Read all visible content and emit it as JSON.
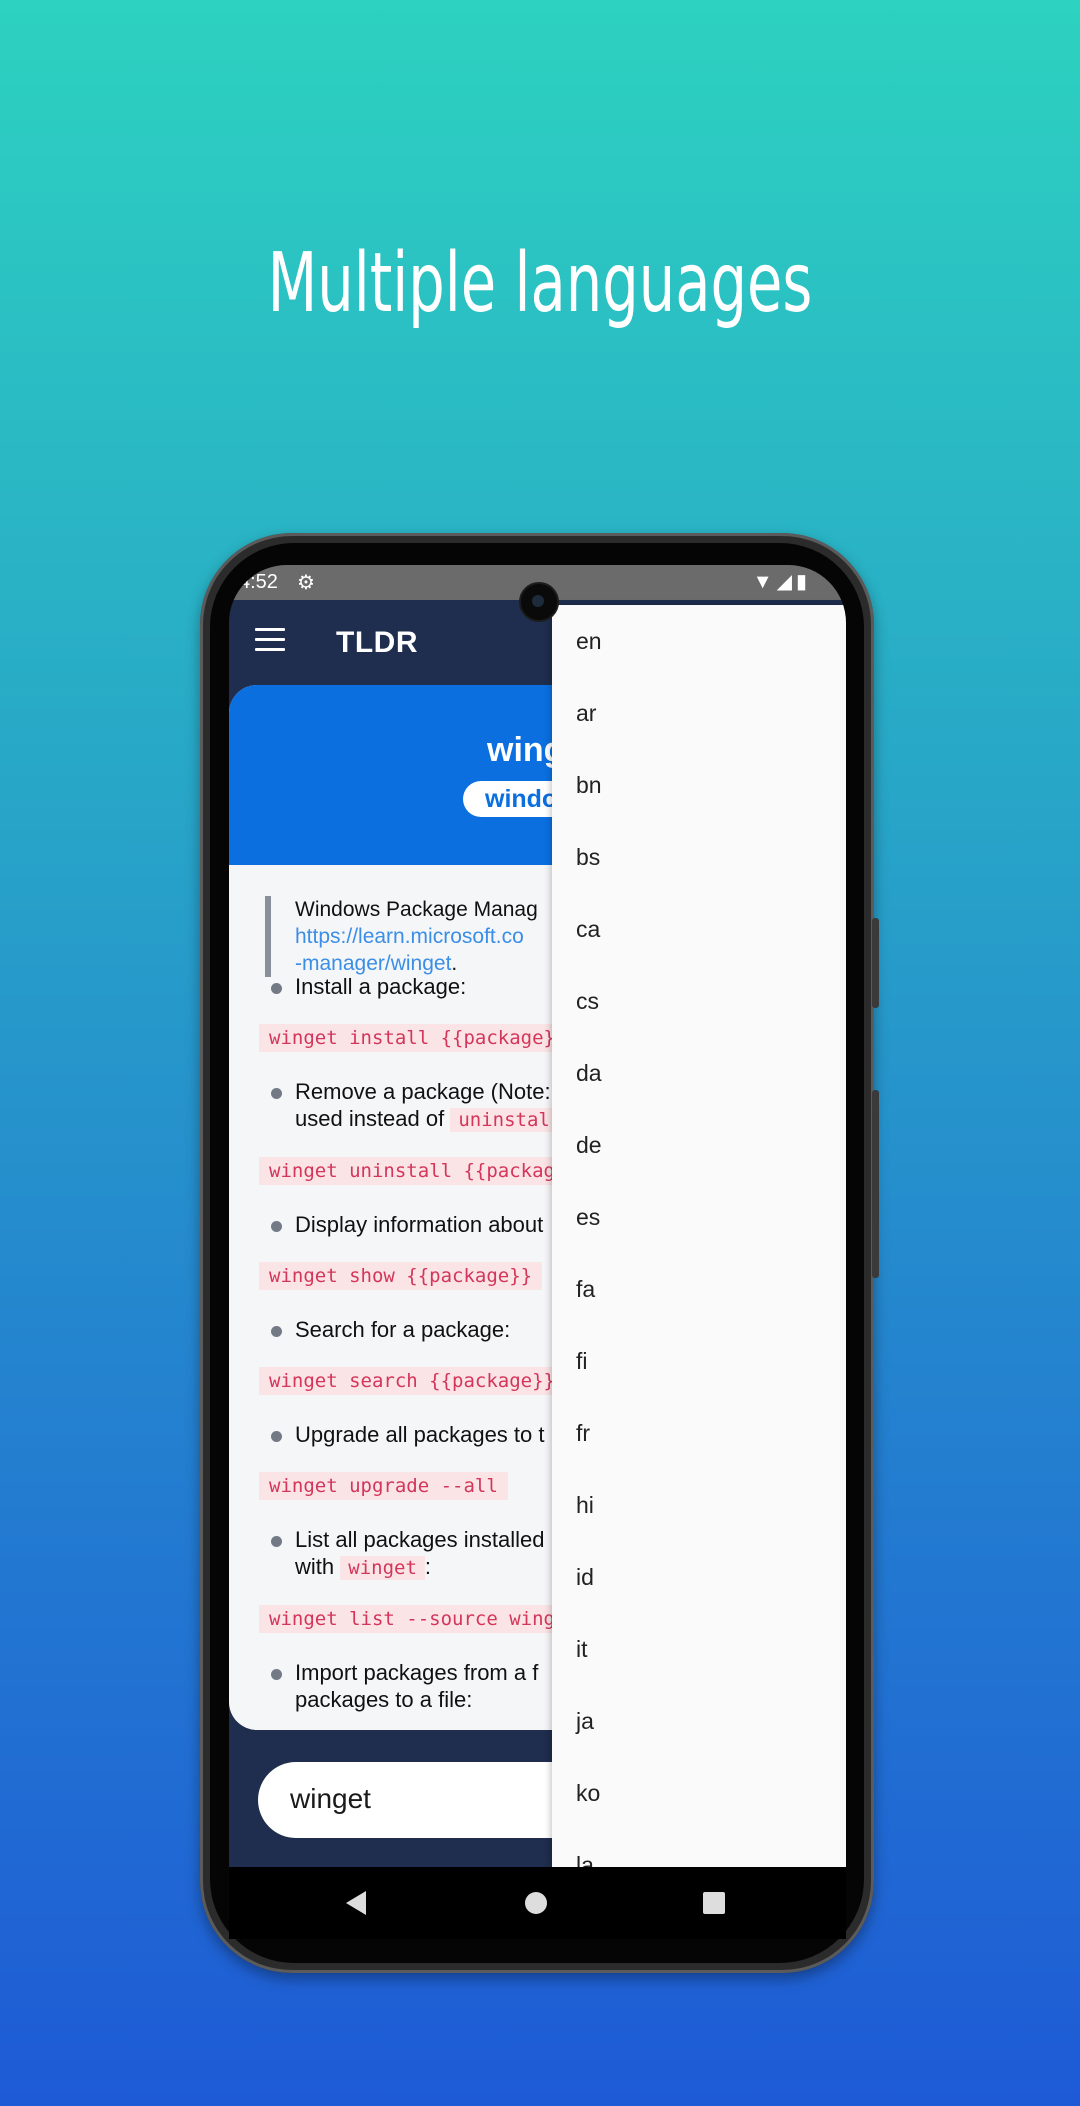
{
  "headline": "Multiple languages",
  "status_bar": {
    "time": "4:52"
  },
  "app": {
    "title": "TLDR"
  },
  "page": {
    "command": "wing",
    "platform": "windo",
    "description": "Windows Package Manag",
    "link_line1": "https://learn.microsoft.co",
    "link_line2": "-manager/winget",
    "link_period": ".",
    "entries": [
      {
        "text": "Install a package:",
        "code": "winget install {{package}}"
      },
      {
        "text1": "Remove a package (Note:",
        "text2_prefix": "used instead of",
        "inline": "uninstal",
        "code": "winget uninstall {{package"
      },
      {
        "text": "Display information about",
        "code": "winget show {{package}}"
      },
      {
        "text": "Search for a package:",
        "code": "winget search {{package}}"
      },
      {
        "text": "Upgrade all packages to t",
        "code": "winget upgrade --all"
      },
      {
        "text1": "List all packages installed",
        "text2_prefix": "with",
        "inline": "winget",
        "text2_suffix": ":",
        "code": "winget list --source winge"
      },
      {
        "text1": "Import packages from a f",
        "text2": "packages to a file:"
      }
    ]
  },
  "search": {
    "value": "winget"
  },
  "languages": [
    "en",
    "ar",
    "bn",
    "bs",
    "ca",
    "cs",
    "da",
    "de",
    "es",
    "fa",
    "fi",
    "fr",
    "hi",
    "id",
    "it",
    "ja",
    "ko",
    "la"
  ]
}
